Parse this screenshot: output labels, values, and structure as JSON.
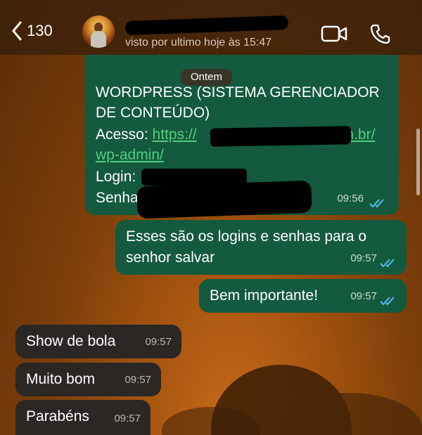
{
  "header": {
    "back_count": "130",
    "status": "visto por ultimo hoje às 15:47",
    "icons": [
      "back-chevron-icon",
      "video-call-icon",
      "voice-call-icon"
    ]
  },
  "date_chip": "Ontem",
  "messages": [
    {
      "direction": "outgoing",
      "lines": {
        "l1": "WORDPRESS (SISTEMA GERENCIADOR",
        "l2": "DE CONTEÚDO)",
        "access_label": "Acesso:",
        "link_start": "https://",
        "link_end": ".com.br/",
        "link_line2": "wp-admin/",
        "login_label": "Login:",
        "password_label": "Senha"
      },
      "time": "09:56",
      "read": true
    },
    {
      "direction": "outgoing",
      "line1": "Esses são os logins e senhas para o",
      "line2": "senhor salvar",
      "time": "09:57",
      "read": true
    },
    {
      "direction": "outgoing",
      "text": "Bem importante!",
      "time": "09:57",
      "read": true
    },
    {
      "direction": "incoming",
      "text": "Show de bola",
      "time": "09:57"
    },
    {
      "direction": "incoming",
      "text": "Muito bom",
      "time": "09:57"
    },
    {
      "direction": "incoming",
      "text": "Parabéns",
      "time": "09:57"
    }
  ],
  "colors": {
    "outgoing_bubble": "#145a3e",
    "incoming_bubble": "#2b2725",
    "read_ticks": "#53bdeb",
    "link": "#4fcf7e"
  }
}
